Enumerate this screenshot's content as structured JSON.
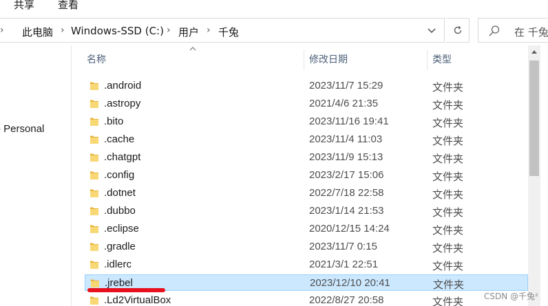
{
  "ribbon": {
    "tabs": [
      "共享",
      "查看"
    ]
  },
  "address": {
    "crumbs": [
      "此电脑",
      "Windows-SSD (C:)",
      "用户",
      "千兔"
    ],
    "separator": "›"
  },
  "search": {
    "placeholder": "在 千兔"
  },
  "nav": {
    "items": [
      "- Personal"
    ]
  },
  "columns": {
    "name": "名称",
    "date": "修改日期",
    "type": "类型"
  },
  "files": [
    {
      "name": ".android",
      "date": "2023/11/7 15:29",
      "type": "文件夹"
    },
    {
      "name": ".astropy",
      "date": "2021/4/6 21:35",
      "type": "文件夹"
    },
    {
      "name": ".bito",
      "date": "2023/11/16 19:41",
      "type": "文件夹"
    },
    {
      "name": ".cache",
      "date": "2023/11/4 11:03",
      "type": "文件夹"
    },
    {
      "name": ".chatgpt",
      "date": "2023/11/9 15:13",
      "type": "文件夹"
    },
    {
      "name": ".config",
      "date": "2023/2/17 15:06",
      "type": "文件夹"
    },
    {
      "name": ".dotnet",
      "date": "2022/7/18 22:58",
      "type": "文件夹"
    },
    {
      "name": ".dubbo",
      "date": "2023/1/14 21:53",
      "type": "文件夹"
    },
    {
      "name": ".eclipse",
      "date": "2020/12/15 14:24",
      "type": "文件夹"
    },
    {
      "name": ".gradle",
      "date": "2023/11/7 0:15",
      "type": "文件夹"
    },
    {
      "name": ".idlerc",
      "date": "2021/3/1 22:51",
      "type": "文件夹"
    },
    {
      "name": ".jrebel",
      "date": "2023/12/10 20:41",
      "type": "文件夹",
      "selected": true
    },
    {
      "name": ".Ld2VirtualBox",
      "date": "2022/8/27 20:58",
      "type": "文件夹"
    }
  ],
  "watermark": "CSDN @千兔²",
  "colors": {
    "selection_bg": "#cce8ff",
    "selection_border": "#99d1ff",
    "folder": "#e8b33a",
    "annotation_red": "#e8101c",
    "header_text": "#4c607a"
  },
  "icons": {
    "folder": "folder-icon",
    "search": "search-icon",
    "refresh": "refresh-icon",
    "dropdown": "chevron-down-icon",
    "sort": "sort-up-icon"
  }
}
